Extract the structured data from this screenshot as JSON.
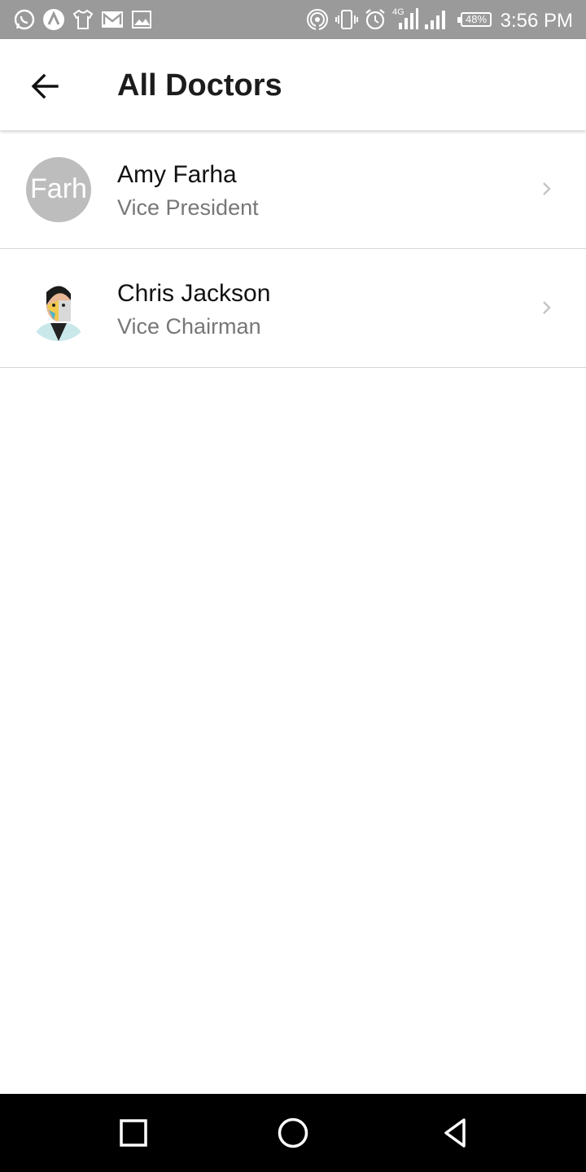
{
  "status_bar": {
    "time": "3:56 PM",
    "battery": "48%",
    "network": "4G",
    "left_icons": [
      "whatsapp-icon",
      "app-icon",
      "shirt-icon",
      "gmail-icon",
      "gallery-icon"
    ],
    "right_icons": [
      "hotspot-icon",
      "vibrate-icon",
      "alarm-icon",
      "signal-icon",
      "signal-icon",
      "battery-icon"
    ]
  },
  "app_bar": {
    "title": "All Doctors",
    "back_icon": "arrow-left-icon"
  },
  "doctors": [
    {
      "name": "Amy Farha",
      "title": "Vice President",
      "avatar_text": "Farh"
    },
    {
      "name": "Chris Jackson",
      "title": "Vice Chairman"
    }
  ],
  "nav_bar": {
    "buttons": [
      "recents-icon",
      "home-icon",
      "back-triangle-icon"
    ]
  },
  "colors": {
    "status_bar_bg": "#9a9a9a",
    "title_text": "#1c1c1c",
    "subtitle_text": "#777777",
    "divider": "#d6d6d6",
    "nav_bar_bg": "#000000"
  }
}
